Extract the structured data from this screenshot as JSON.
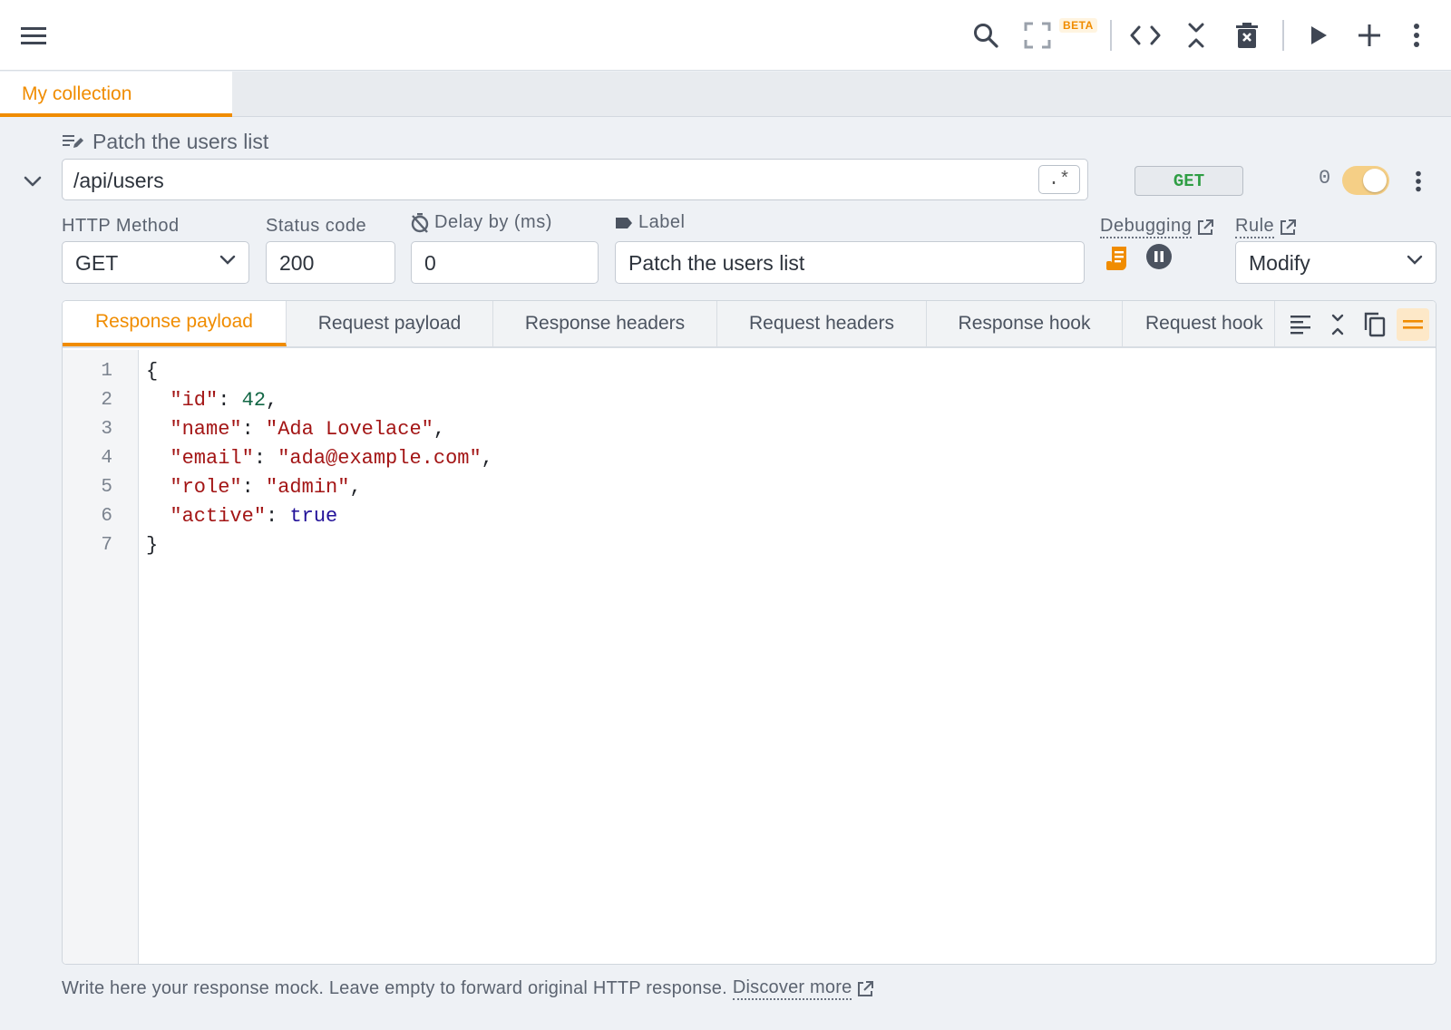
{
  "toolbar": {
    "beta_badge": "BETA"
  },
  "collection_tab": {
    "label": "My collection"
  },
  "rule": {
    "title": "Patch the users list",
    "url_pattern": "/api/users",
    "regex_toggle": ".*",
    "method_badge": "GET",
    "hit_count": "0"
  },
  "form": {
    "http_method_label": "HTTP Method",
    "http_method_value": "GET",
    "status_code_label": "Status code",
    "status_code_value": "200",
    "delay_label": "Delay by (ms)",
    "delay_value": "0",
    "label_label": "Label",
    "label_value": "Patch the users list",
    "debugging_label": "Debugging",
    "rule_label": "Rule",
    "rule_value": "Modify"
  },
  "editor": {
    "tabs": [
      {
        "label": "Response payload"
      },
      {
        "label": "Request payload"
      },
      {
        "label": "Response headers"
      },
      {
        "label": "Request headers"
      },
      {
        "label": "Response hook"
      },
      {
        "label": "Request hook"
      }
    ],
    "line_numbers": [
      "1",
      "2",
      "3",
      "4",
      "5",
      "6",
      "7"
    ],
    "code": {
      "l1": "{",
      "l2_key": "\"id\"",
      "l2_val": "42",
      "l3_key": "\"name\"",
      "l3_val": "\"Ada Lovelace\"",
      "l4_key": "\"email\"",
      "l4_val": "\"ada@example.com\"",
      "l5_key": "\"role\"",
      "l5_val": "\"admin\"",
      "l6_key": "\"active\"",
      "l6_val": "true",
      "l7": "}"
    }
  },
  "hint": {
    "text": "Write here your response mock. Leave empty to forward original HTTP response.",
    "link": "Discover more"
  },
  "colors": {
    "accent": "#f08c00",
    "method_green": "#2f9e44"
  }
}
